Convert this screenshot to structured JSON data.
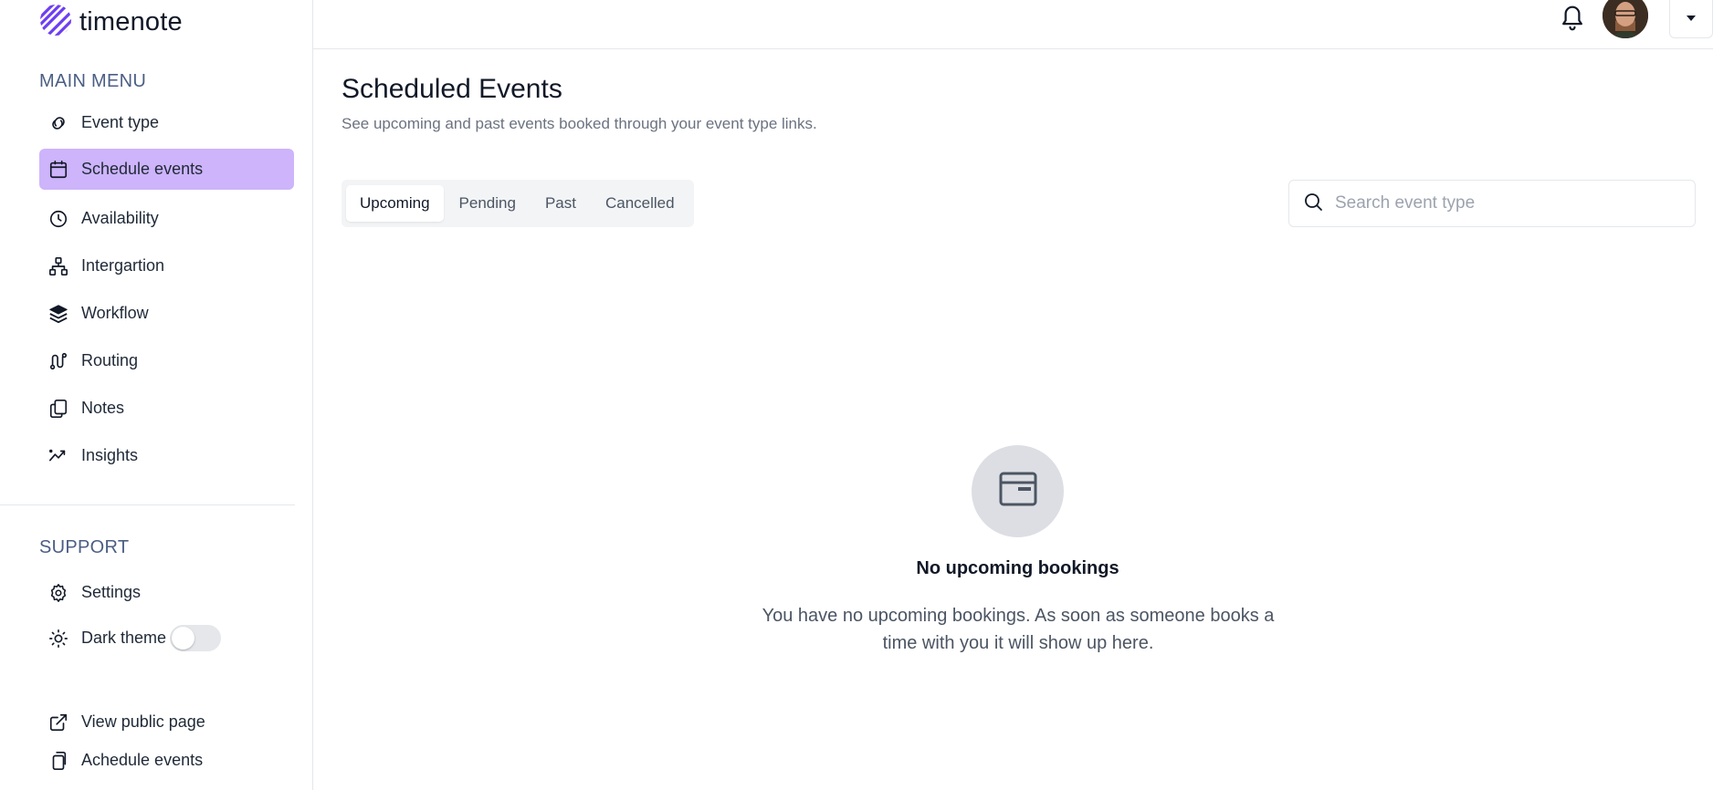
{
  "brand": {
    "name": "timenote"
  },
  "sidebar": {
    "main_menu_label": "MAIN MENU",
    "main_items": [
      {
        "label": "Event type",
        "icon": "link-icon"
      },
      {
        "label": "Schedule events",
        "icon": "calendar-icon",
        "active": true
      },
      {
        "label": "Availability",
        "icon": "clock-icon"
      },
      {
        "label": "Intergartion",
        "icon": "integration-icon"
      },
      {
        "label": "Workflow",
        "icon": "layers-icon"
      },
      {
        "label": "Routing",
        "icon": "route-icon"
      },
      {
        "label": "Notes",
        "icon": "notes-icon"
      },
      {
        "label": "Insights",
        "icon": "insights-icon"
      }
    ],
    "support_label": "SUPPORT",
    "support_items": [
      {
        "label": "Settings",
        "icon": "gear-icon"
      },
      {
        "label": "Dark theme",
        "icon": "sun-icon",
        "toggle": false
      }
    ],
    "footer_items": [
      {
        "label": "View public page",
        "icon": "external-link-icon"
      },
      {
        "label": "Achedule events",
        "icon": "copy-icon"
      }
    ]
  },
  "header": {
    "notifications_icon": "bell-icon",
    "avatar_icon": "user-avatar",
    "menu_icon": "chevron-down-icon"
  },
  "main": {
    "title": "Scheduled Events",
    "subtitle": "See upcoming and past events booked through your event type links.",
    "tabs": [
      {
        "label": "Upcoming",
        "active": true
      },
      {
        "label": "Pending"
      },
      {
        "label": "Past"
      },
      {
        "label": "Cancelled"
      }
    ],
    "search": {
      "placeholder": "Search event type",
      "value": ""
    },
    "empty_state": {
      "icon": "calendar-window-icon",
      "title": "No upcoming bookings",
      "description": "You have no upcoming bookings. As soon as someone books a time with you it will show up here."
    }
  },
  "colors": {
    "accent": "#cdb4fb",
    "logo": "#6d3ef0",
    "border": "#e5e7eb",
    "muted_text": "#6b7280"
  }
}
